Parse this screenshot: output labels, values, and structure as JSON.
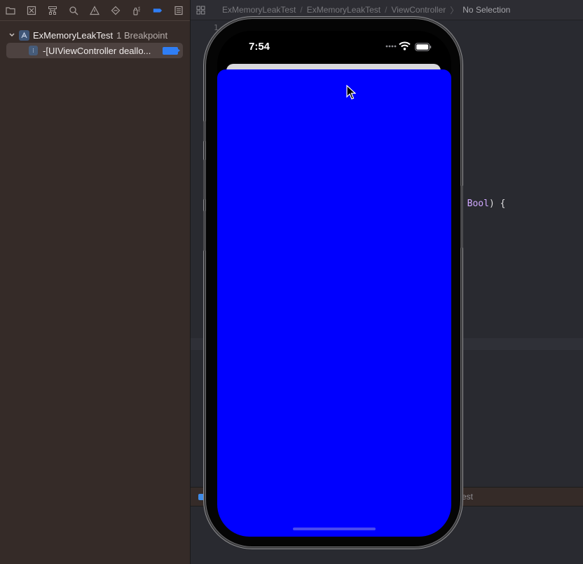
{
  "navigator": {
    "toolbar_icons": [
      "folder-icon",
      "source-control-icon",
      "hierarchy-icon",
      "search-icon",
      "warning-icon",
      "test-diamond-icon",
      "debug-spray-icon",
      "breakpoint-icon",
      "report-icon"
    ],
    "active_icon": "breakpoint-icon",
    "project": {
      "name": "ExMemoryLeakTest",
      "count": "1 Breakpoint"
    },
    "breakpoint": {
      "label": "-[UIViewController deallo...",
      "tag_color": "#2f7ef5"
    }
  },
  "editor": {
    "breadcrumbs": [
      "ExMemoryLeakTest",
      "ExMemoryLeakTest",
      "ViewController",
      "No Selection"
    ],
    "line_number": "1",
    "code_line": {
      "punct": ": ",
      "type": "Bool",
      "rest": ") {"
    },
    "debug_bar_text": "Test"
  },
  "simulator": {
    "time": "7:54",
    "view_color": "#0000ff"
  }
}
